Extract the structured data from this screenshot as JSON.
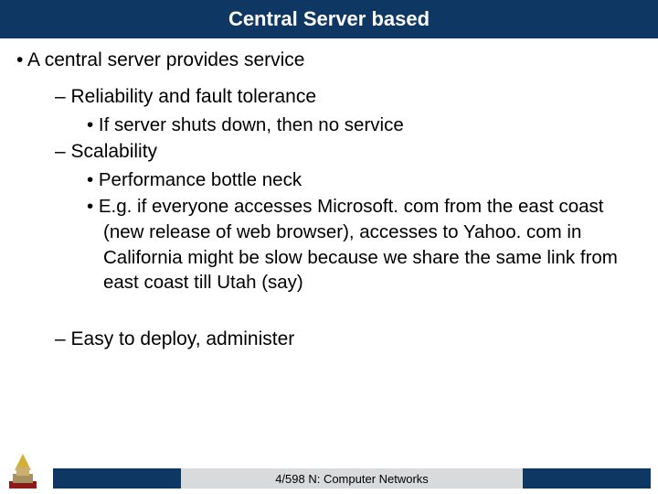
{
  "title": "Central Server based",
  "bullets": {
    "main": "A central server provides service",
    "sub1": "Reliability and fault tolerance",
    "sub1a": "If server shuts down, then no service",
    "sub2": "Scalability",
    "sub2a": "Performance bottle neck",
    "sub2b": "E.g. if everyone accesses Microsoft. com from the east coast (new release of web browser), accesses to Yahoo. com in California might be slow because we share the same link from east coast till Utah (say)",
    "sub3": "Easy to deploy, administer"
  },
  "footer": "4/598 N: Computer Networks"
}
